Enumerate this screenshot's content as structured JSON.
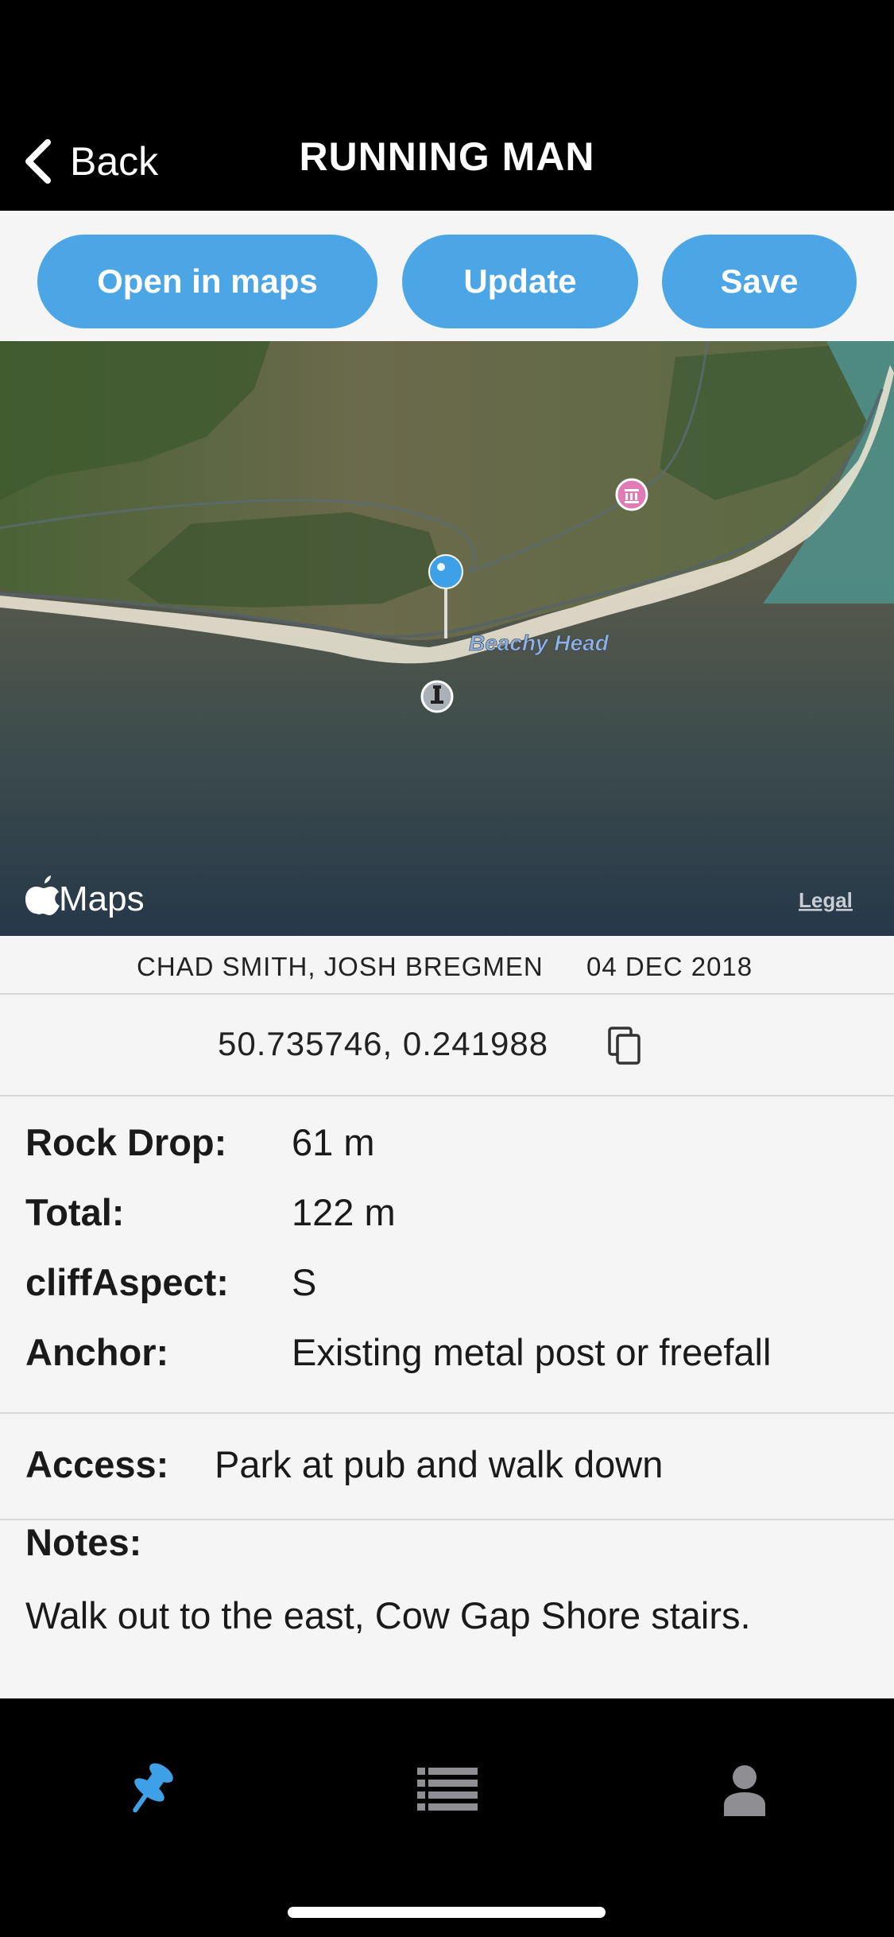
{
  "nav": {
    "back_label": "Back",
    "title": "RUNNING MAN"
  },
  "actions": {
    "open_maps": "Open in maps",
    "update": "Update",
    "save": "Save"
  },
  "map": {
    "place_label": "Beachy Head",
    "brand": "Maps",
    "legal": "Legal"
  },
  "meta": {
    "names": "CHAD SMITH, JOSH BREGMEN",
    "date": "04 DEC 2018"
  },
  "coords": {
    "value": "50.735746, 0.241988"
  },
  "details": [
    {
      "label": "Rock Drop:",
      "value": "61 m"
    },
    {
      "label": "Total:",
      "value": "122 m"
    },
    {
      "label": "cliffAspect:",
      "value": "S"
    },
    {
      "label": "Anchor:",
      "value": "Existing metal post or freefall"
    }
  ],
  "access": {
    "label": "Access:",
    "value": "Park at pub and walk down"
  },
  "notes": {
    "label": "Notes:",
    "value": "Walk out to the east, Cow Gap Shore stairs."
  },
  "tabs": {
    "active": "pin-tab",
    "accent": "#3ea0e6"
  },
  "colors": {
    "button": "#4ca6e6",
    "background": "#f5f5f5"
  }
}
